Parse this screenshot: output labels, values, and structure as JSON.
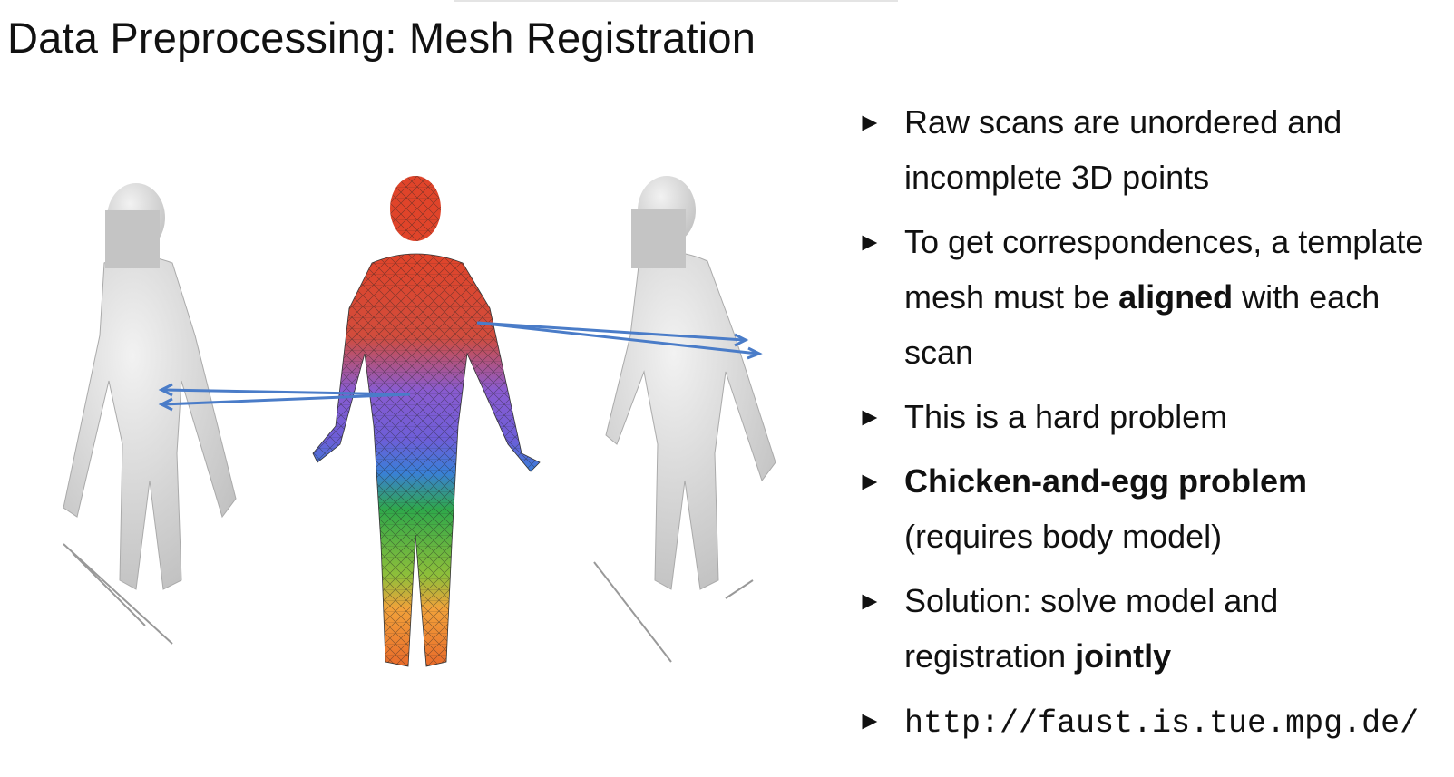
{
  "title": "Data Preprocessing: Mesh Registration",
  "bullets": [
    {
      "t1": "Raw scans are unordered and incomplete 3D points"
    },
    {
      "t1": "To get correspondences, a template mesh must be ",
      "bold": "aligned",
      "t2": " with each scan"
    },
    {
      "t1": "This is a hard problem"
    },
    {
      "bold": "Chicken-and-egg problem",
      "t2": " (requires body model)"
    },
    {
      "t1": "Solution: solve model and registration ",
      "bold": "jointly"
    },
    {
      "mono": "http://faust.is.tue.mpg.de/"
    }
  ],
  "bullet_marker": "►",
  "colors": {
    "arrow": "#4a7cc8",
    "scan_gray": "#d8d8d8",
    "face_blur": "#c4c4c4"
  }
}
